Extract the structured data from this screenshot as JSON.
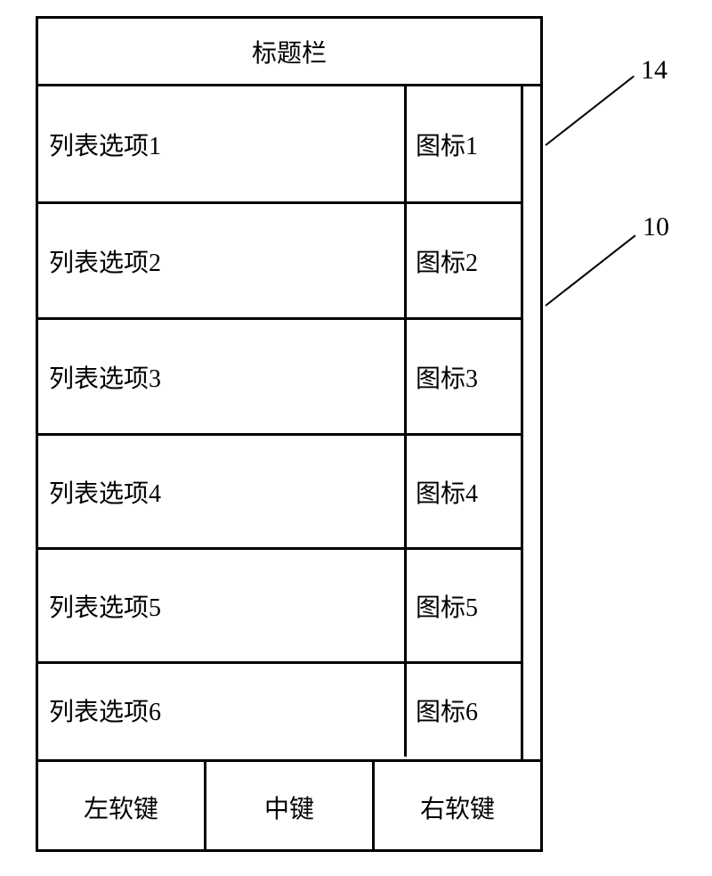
{
  "titlebar": "标题栏",
  "list": [
    {
      "label": "列表选项1",
      "icon": "图标1"
    },
    {
      "label": "列表选项2",
      "icon": "图标2"
    },
    {
      "label": "列表选项3",
      "icon": "图标3"
    },
    {
      "label": "列表选项4",
      "icon": "图标4"
    },
    {
      "label": "列表选项5",
      "icon": "图标5"
    },
    {
      "label": "列表选项6",
      "icon": "图标6"
    }
  ],
  "softkeys": {
    "left": "左软键",
    "middle": "中键",
    "right": "右软键"
  },
  "annotations": {
    "a14": "14",
    "a10": "10"
  }
}
